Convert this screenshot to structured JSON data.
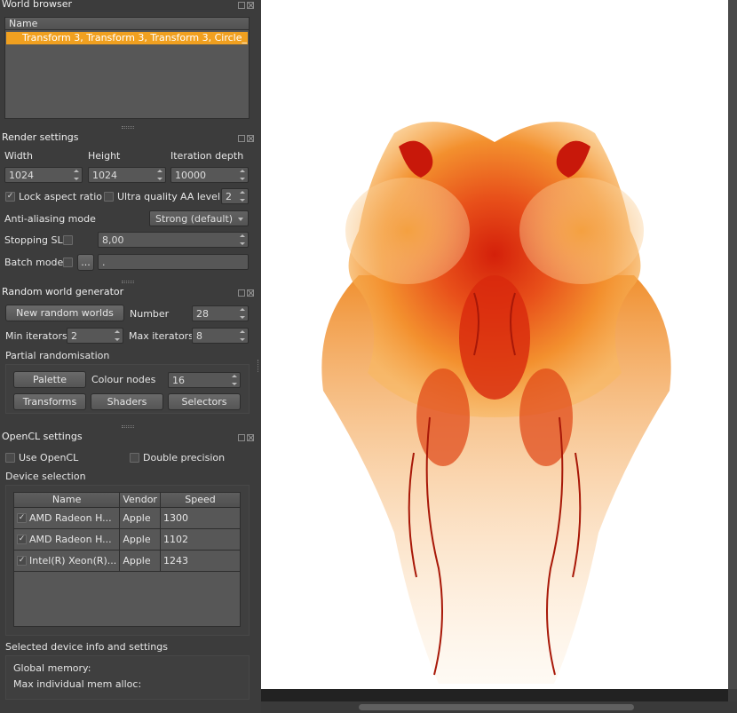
{
  "world_browser": {
    "title": "World browser",
    "col_name": "Name",
    "rows": [
      "Transform 3, Transform 3, Transform 3, Circle_..."
    ]
  },
  "render_settings": {
    "title": "Render settings",
    "width_label": "Width",
    "width_value": "1024",
    "height_label": "Height",
    "height_value": "1024",
    "depth_label": "Iteration depth",
    "depth_value": "10000",
    "lock_aspect_label": "Lock aspect ratio",
    "lock_aspect_checked": true,
    "ultra_quality_label": "Ultra quality",
    "ultra_quality_checked": false,
    "aa_level_label": "AA level",
    "aa_level_value": "2",
    "aa_mode_label": "Anti-aliasing mode",
    "aa_mode_value": "Strong (default)",
    "stopping_sl_label": "Stopping SL",
    "stopping_sl_value": "8,00",
    "stopping_sl_checked": false,
    "batch_mode_label": "Batch mode",
    "batch_mode_checked": false,
    "batch_button": "...",
    "batch_path": "."
  },
  "random_world": {
    "title": "Random world generator",
    "new_button": "New random worlds",
    "number_label": "Number",
    "number_value": "28",
    "min_iter_label": "Min iterators",
    "min_iter_value": "2",
    "max_iter_label": "Max iterators",
    "max_iter_value": "8",
    "partial_label": "Partial randomisation",
    "palette_button": "Palette",
    "colour_nodes_label": "Colour nodes",
    "colour_nodes_value": "16",
    "transforms_button": "Transforms",
    "shaders_button": "Shaders",
    "selectors_button": "Selectors"
  },
  "opencl": {
    "title": "OpenCL settings",
    "use_opencl_label": "Use OpenCL",
    "use_opencl_checked": false,
    "double_precision_label": "Double precision",
    "double_precision_checked": false,
    "device_selection_label": "Device selection",
    "columns": [
      "Name",
      "Vendor",
      "Speed"
    ],
    "devices": [
      {
        "checked": true,
        "name": "AMD Radeon H...",
        "vendor": "Apple",
        "speed": "1300"
      },
      {
        "checked": true,
        "name": "AMD Radeon H...",
        "vendor": "Apple",
        "speed": "1102"
      },
      {
        "checked": true,
        "name": "Intel(R) Xeon(R)...",
        "vendor": "Apple",
        "speed": "1243"
      }
    ],
    "selected_info_label": "Selected device info and settings",
    "global_memory_label": "Global memory:",
    "max_alloc_label": "Max individual mem alloc:"
  },
  "colors": {
    "accent": "#f0a020",
    "panel": "#3c3c3c",
    "canvas": "#ffffff"
  }
}
